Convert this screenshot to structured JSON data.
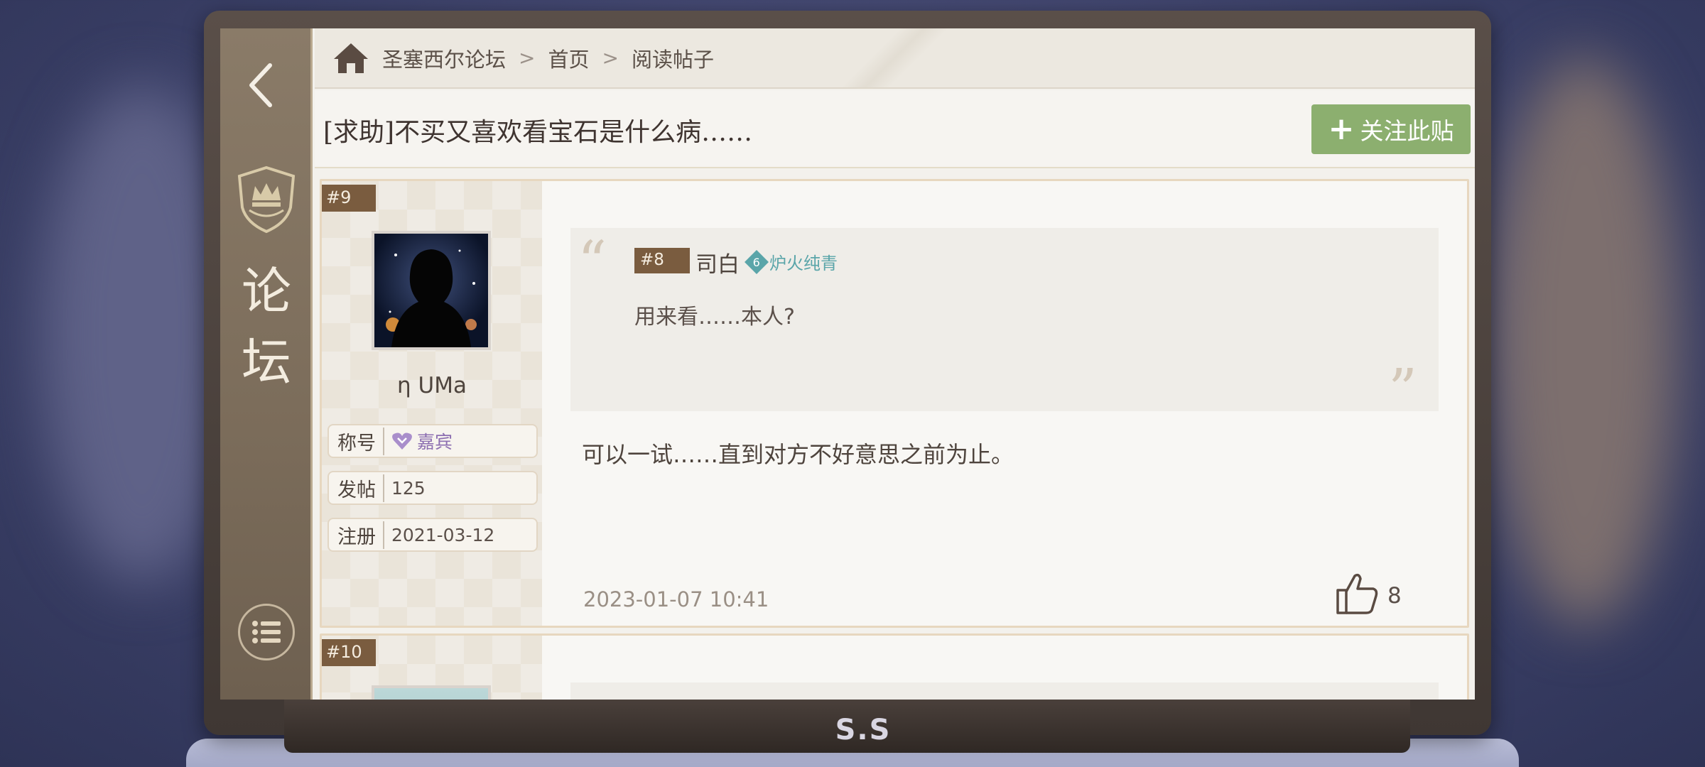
{
  "device": {
    "brand": "S.S"
  },
  "rail": {
    "title_line1": "论",
    "title_line2": "坛"
  },
  "breadcrumb": {
    "forum": "圣塞西尔论坛",
    "home": "首页",
    "current": "阅读帖子"
  },
  "thread": {
    "title": "[求助]不买又喜欢看宝石是什么病……",
    "follow_label": "关注此贴"
  },
  "posts": [
    {
      "floor": "#9",
      "username": "η UMa",
      "stats": [
        {
          "label": "称号",
          "value": "嘉宾"
        },
        {
          "label": "发帖",
          "value": "125"
        },
        {
          "label": "注册",
          "value": "2021-03-12"
        }
      ],
      "quote": {
        "floor": "#8",
        "author": "司白",
        "rank_level": "6",
        "rank_name": "炉火纯青",
        "text": "用来看……本人?"
      },
      "content": "可以一试……直到对方不好意思之前为止。",
      "time": "2023-01-07  10:41",
      "likes": "8"
    },
    {
      "floor": "#10"
    }
  ],
  "colors": {
    "accent_green": "#8caf6f",
    "floor_tag": "#7a5c3f",
    "rank_teal": "#5aa5a9",
    "badge_purple": "#8d6fb1"
  }
}
